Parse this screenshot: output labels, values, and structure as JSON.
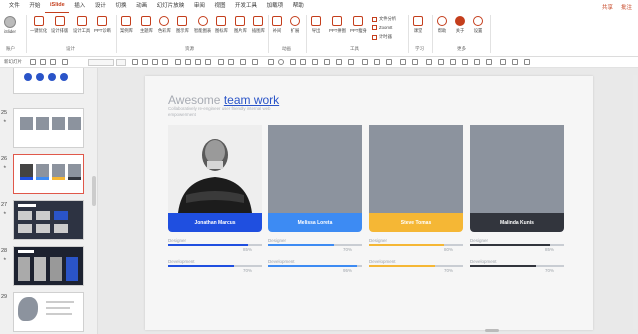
{
  "menu": {
    "tabs": [
      "文件",
      "开始",
      "iSlide",
      "插入",
      "设计",
      "切换",
      "动画",
      "幻灯片放映",
      "审阅",
      "视图",
      "开发工具",
      "加载项",
      "帮助"
    ],
    "active_tab": "iSlide",
    "share": "共享",
    "annotate": "批注"
  },
  "ribbon": {
    "account": "iSlider",
    "buttons": {
      "one_click": "一键优化",
      "design_layout": "设计排版",
      "design_tools": "设计工具",
      "ppt_diagnose": "PPT诊断",
      "case_lib": "案例库",
      "theme_lib": "主题库",
      "color_lib": "色彩库",
      "diagram_lib": "图示库",
      "smart_chart": "智能图表",
      "icon_lib": "图标库",
      "pic_lib": "图片库",
      "illus_lib": "插图库",
      "supplement": "补间",
      "extension": "扩展",
      "export": "导出",
      "ppt_thumb": "PPT拼图",
      "ppt_slim": "PPT瘦身",
      "learn": "课堂",
      "help": "帮助",
      "about": "关于",
      "settings": "设置"
    },
    "small_items": [
      "文件分析",
      "ZoomIt",
      "计时器"
    ],
    "groups": {
      "account": "账户",
      "design": "设计",
      "resources": "资源",
      "animation": "动画",
      "tools": "工具",
      "learning": "学习",
      "more": "更多"
    }
  },
  "format_bar": {
    "new_slide": "新幻灯片"
  },
  "thumbnails": {
    "numbers": [
      "25",
      "26",
      "27",
      "28",
      "29"
    ],
    "selected": "26"
  },
  "slide": {
    "title_plain": "Awesome ",
    "title_highlight": "team work",
    "subtitle": "Collaboratively re-engineer user friendly internal web empowerment",
    "members": [
      {
        "name": "Jonathan Marcus",
        "color": "#1f4fe0"
      },
      {
        "name": "Melissa Loreta",
        "color": "#3d8bf3"
      },
      {
        "name": "Steve Tomas",
        "color": "#f5b735"
      },
      {
        "name": "Malinda Kunis",
        "color": "#32353d"
      }
    ],
    "skills": [
      {
        "design_label": "Designer",
        "design_pct": "85%",
        "design_value": 0.85,
        "dev_label": "Development",
        "dev_pct": "70%",
        "dev_value": 0.7
      },
      {
        "design_label": "Designer",
        "design_pct": "70%",
        "design_value": 0.7,
        "dev_label": "Development",
        "dev_pct": "95%",
        "dev_value": 0.95
      },
      {
        "design_label": "Designer",
        "design_pct": "80%",
        "design_value": 0.8,
        "dev_label": "Development",
        "dev_pct": "70%",
        "dev_value": 0.7
      },
      {
        "design_label": "Designer",
        "design_pct": "85%",
        "design_value": 0.85,
        "dev_label": "Development",
        "dev_pct": "70%",
        "dev_value": 0.7
      }
    ]
  }
}
